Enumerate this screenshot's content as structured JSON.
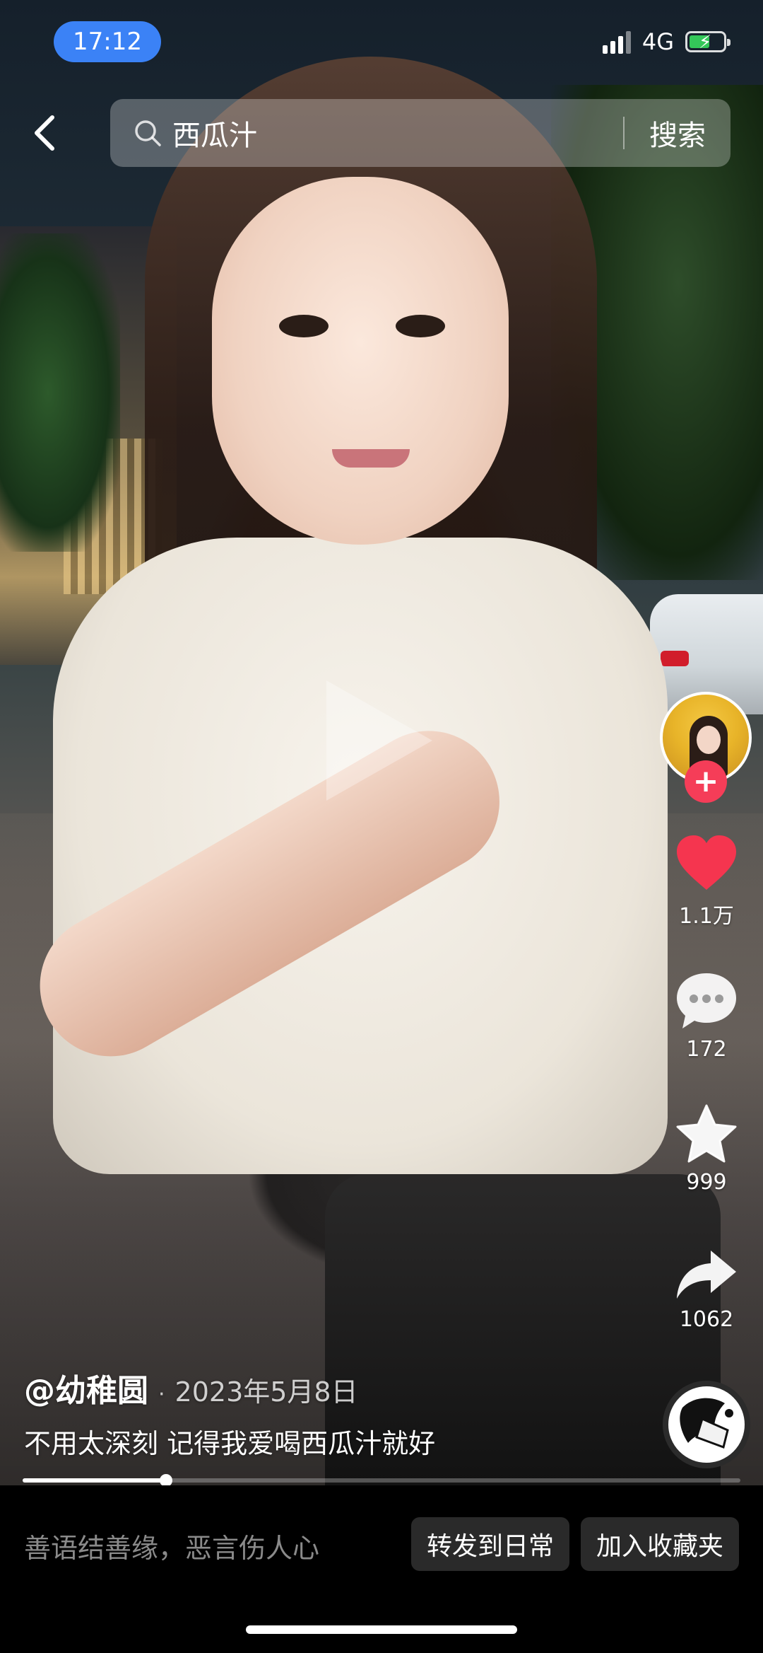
{
  "status_bar": {
    "time": "17:12",
    "network": "4G",
    "battery_level": 0.6,
    "battery_color": "#34c759",
    "time_pill_color": "#3b82f6"
  },
  "search": {
    "query": "西瓜汁",
    "submit_label": "搜索",
    "back_icon": "chevron-left-icon",
    "search_icon": "magnifier-icon"
  },
  "rail": {
    "follow_symbol": "+",
    "like_count": "1.1万",
    "comment_count": "172",
    "favorite_count": "999",
    "share_count": "1062",
    "like_color": "#f5354f",
    "follow_color": "#f53d58"
  },
  "post": {
    "author": "@幼稚圆",
    "separator": "·",
    "date": "2023年5月8日",
    "description": "不用太深刻 记得我爱喝西瓜汁就好",
    "progress": 0.2
  },
  "bottom_bar": {
    "comment_placeholder": "善语结善缘，恶言伤人心",
    "share_daily_label": "转发到日常",
    "add_favorites_label": "加入收藏夹"
  }
}
